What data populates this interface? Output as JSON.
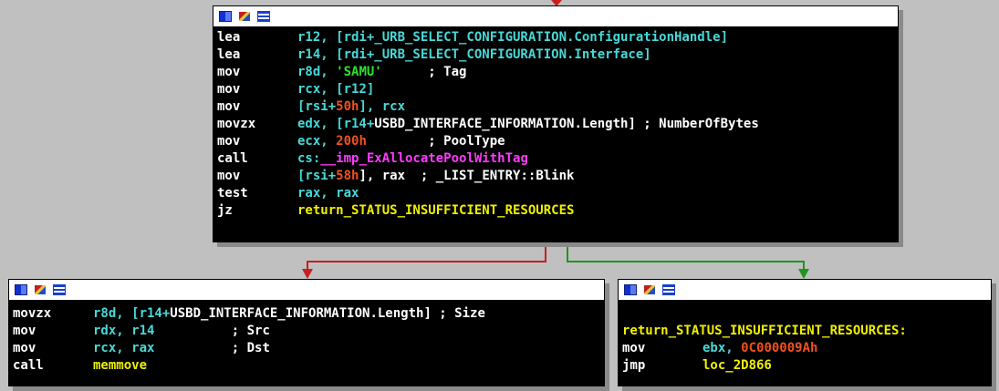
{
  "colors": {
    "background": "#c0c0c0",
    "node_bg": "#000000",
    "edge_false": "#c81e1e",
    "edge_true": "#1e961e",
    "edge_normal": "#3a6fd0"
  },
  "header_icons": [
    "graph-overview-icon",
    "edit-pen-icon",
    "listing-view-icon"
  ],
  "nodes": {
    "top": {
      "lines": [
        {
          "mnemonic": "lea",
          "operand": "r12, [rdi+_URB_SELECT_CONFIGURATION.ConfigurationHandle]"
        },
        {
          "mnemonic": "lea",
          "operand": "r14, [rdi+_URB_SELECT_CONFIGURATION.Interface]"
        },
        {
          "mnemonic": "mov",
          "op1": "r8d, ",
          "op2": "'SAMU'",
          "op3": "      ; Tag"
        },
        {
          "mnemonic": "mov",
          "operand": "rcx, [r12]"
        },
        {
          "mnemonic": "mov",
          "op1": "[rsi+",
          "op2": "50h",
          "op3": "], rcx"
        },
        {
          "mnemonic": "movzx",
          "op1": "edx, [r14+",
          "op2": "USBD_INTERFACE_INFORMATION.Length",
          "op3": "] ; NumberOfBytes"
        },
        {
          "mnemonic": "mov",
          "op1": "ecx, ",
          "op2": "200h",
          "op3": "        ; PoolType"
        },
        {
          "mnemonic": "call",
          "op1": "cs:",
          "op2": "__imp_ExAllocatePoolWithTag"
        },
        {
          "mnemonic": "mov",
          "op1": "[rsi+",
          "op2": "58h",
          "op3": "], rax  ; _LIST_ENTRY::Blink"
        },
        {
          "mnemonic": "test",
          "operand": "rax, rax"
        },
        {
          "mnemonic": "jz",
          "operand": "return_STATUS_INSUFFICIENT_RESOURCES"
        }
      ]
    },
    "left": {
      "lines": [
        {
          "mnemonic": "movzx",
          "op1": "r8d, [r14+",
          "op2": "USBD_INTERFACE_INFORMATION.Length",
          "op3": "] ; Size"
        },
        {
          "mnemonic": "mov",
          "op1": "rdx, r14",
          "op3": "          ; Src"
        },
        {
          "mnemonic": "mov",
          "op1": "rcx, rax",
          "op3": "          ; Dst"
        },
        {
          "mnemonic": "call",
          "operand": "memmove"
        }
      ]
    },
    "right": {
      "label": "return_STATUS_INSUFFICIENT_RESOURCES:",
      "lines": [
        {
          "mnemonic": "mov",
          "op1": "ebx, ",
          "op2": "0C000009Ah"
        },
        {
          "mnemonic": "jmp",
          "operand": "loc_2D866"
        }
      ]
    }
  }
}
